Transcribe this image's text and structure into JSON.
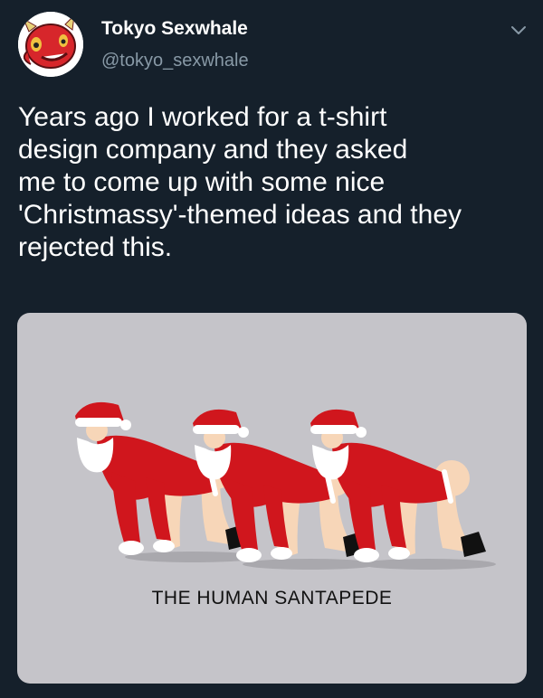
{
  "author": {
    "display_name": "Tokyo Sexwhale",
    "handle": "@tokyo_sexwhale",
    "avatar_icon": "red-devil-face-icon"
  },
  "tweet": {
    "text": "Years ago I worked for a t-shirt\ndesign company and they asked\nme to come up with some nice\n'Christmassy'-themed ideas and they\nrejected this."
  },
  "media": {
    "caption": "THE HUMAN SANTAPEDE",
    "background_color": "#c5c4c9"
  },
  "menu": {
    "icon": "chevron-down-icon"
  },
  "colors": {
    "background": "#15202b",
    "text_primary": "#ffffff",
    "text_secondary": "#8899a6",
    "santa_red": "#d0161d"
  }
}
